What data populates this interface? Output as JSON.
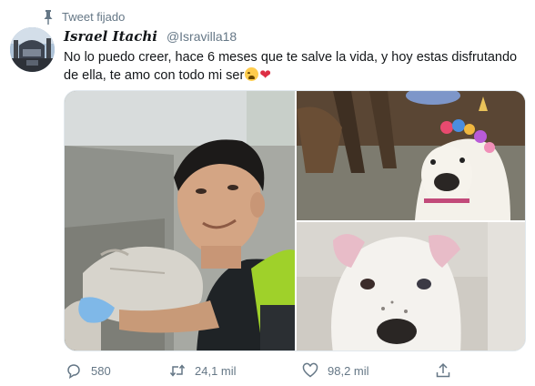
{
  "pinned": {
    "label": "Tweet fijado"
  },
  "author": {
    "display_name": "Israel Itachi",
    "handle": "@Isravilla18"
  },
  "tweet": {
    "text": "No lo puedo creer, hace 6 meses que te salve la vida, y hoy estas disfrutando de ella, te amo con todo mi ser",
    "emojis": [
      "crying-face",
      "red-heart"
    ]
  },
  "media": {
    "images": [
      {
        "name": "selfie-with-rescued-dog"
      },
      {
        "name": "dog-with-flower-crown"
      },
      {
        "name": "dog-closeup-with-bow"
      }
    ]
  },
  "actions": {
    "replies": "580",
    "retweets": "24,1 mil",
    "likes": "98,2 mil"
  },
  "colors": {
    "text": "#14171a",
    "secondary": "#657786",
    "heart": "#dd2e44",
    "border": "#e1e8ed"
  }
}
